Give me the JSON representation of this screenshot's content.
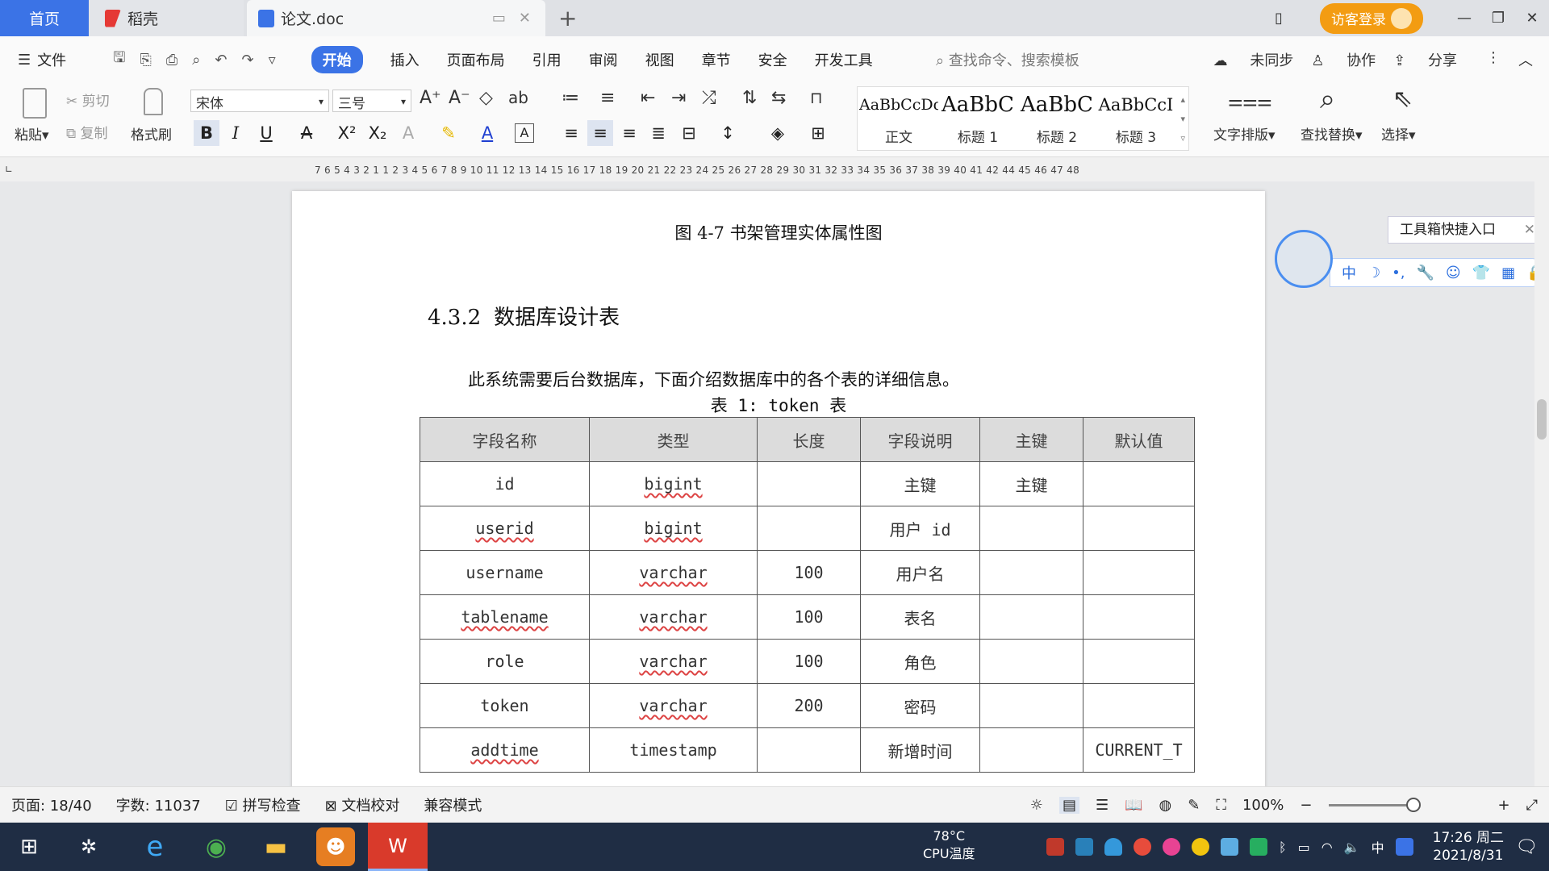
{
  "tabs": {
    "home": "首页",
    "daoke": "稻壳",
    "doc": "论文.doc"
  },
  "titlebar": {
    "login": "访客登录"
  },
  "menu": {
    "file": "文件",
    "items": [
      "开始",
      "插入",
      "页面布局",
      "引用",
      "审阅",
      "视图",
      "章节",
      "安全",
      "开发工具"
    ],
    "search_placeholder": "查找命令、搜索模板",
    "unsync": "未同步",
    "collab": "协作",
    "share": "分享"
  },
  "ribbon": {
    "paste": "粘贴",
    "cut": "剪切",
    "copy": "复制",
    "format_painter": "格式刷",
    "font": "宋体",
    "size": "三号",
    "styles": [
      {
        "preview": "AaBbCcDd",
        "label": "正文"
      },
      {
        "preview": "AaBbC",
        "label": "标题 1"
      },
      {
        "preview": "AaBbC",
        "label": "标题 2"
      },
      {
        "preview": "AaBbCcI",
        "label": "标题 3"
      }
    ],
    "text_layout": "文字排版",
    "find_replace": "查找替换",
    "select": "选择"
  },
  "ruler": {
    "numbers": "7 6 5 4 3 2 1   1 2 3 4 5 6 7 8 9 10 11 12 13 14 15 16 17 18 19 20 21 22 23 24 25 26 27 28 29 30 31 32 33 34 35 36 37 38 39 40 41 42   44 45 46 47 48"
  },
  "document": {
    "figure_caption": "图 4-7 书架管理实体属性图",
    "section_number": "4.3.2",
    "section_title": "数据库设计表",
    "paragraph": "此系统需要后台数据库，下面介绍数据库中的各个表的详细信息。",
    "table_caption": "表 1:   token 表",
    "table": {
      "headers": [
        "字段名称",
        "类型",
        "长度",
        "字段说明",
        "主键",
        "默认值"
      ],
      "rows": [
        [
          "id",
          "bigint",
          "",
          "主键",
          "主键",
          ""
        ],
        [
          "userid",
          "bigint",
          "",
          "用户 id",
          "",
          ""
        ],
        [
          "username",
          "varchar",
          "100",
          "用户名",
          "",
          ""
        ],
        [
          "tablename",
          "varchar",
          "100",
          "表名",
          "",
          ""
        ],
        [
          "role",
          "varchar",
          "100",
          "角色",
          "",
          ""
        ],
        [
          "token",
          "varchar",
          "200",
          "密码",
          "",
          ""
        ],
        [
          "addtime",
          "timestamp",
          "",
          "新增时间",
          "",
          "CURRENT_T"
        ]
      ]
    }
  },
  "widget": {
    "toolbox_tip": "工具箱快捷入口",
    "icons": [
      "中",
      "☽",
      "•,",
      "🔧",
      "☺",
      "👕",
      "▦",
      "🔒"
    ]
  },
  "status": {
    "page": "页面: 18/40",
    "words": "字数: 11037",
    "spell_check": "拼写检查",
    "doc_proof": "文档校对",
    "compat": "兼容模式",
    "zoom": "100%",
    "zoom_level": 0.5
  },
  "taskbar": {
    "cpu_temp": "78°C",
    "cpu_label": "CPU温度",
    "ime": "中",
    "time": "17:26 周二",
    "date": "2021/8/31"
  },
  "colors": {
    "accent": "#3b73e6",
    "login": "#f39c12",
    "taskbar": "#1f2d44"
  }
}
